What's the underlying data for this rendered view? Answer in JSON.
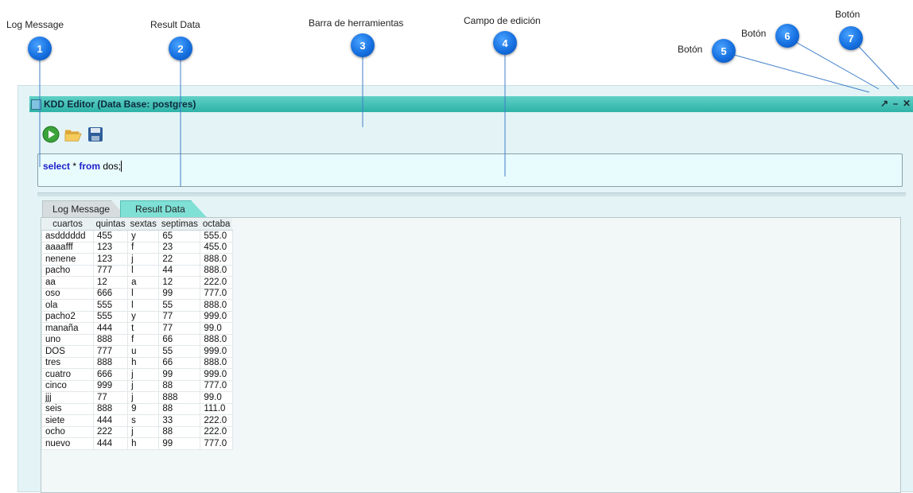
{
  "annotations": [
    {
      "number": "1",
      "label": "Log Message"
    },
    {
      "number": "2",
      "label": "Result Data"
    },
    {
      "number": "3",
      "label": "Barra de herramientas"
    },
    {
      "number": "4",
      "label": "Campo de edición"
    },
    {
      "number": "5",
      "label": "Botón"
    },
    {
      "number": "6",
      "label": "Botón"
    },
    {
      "number": "7",
      "label": "Botón"
    }
  ],
  "window": {
    "title": "KDD Editor (Data Base: postgres)",
    "controls": {
      "restore": "↗",
      "minimize": "–",
      "close": "✕"
    }
  },
  "toolbar": {
    "buttons": [
      {
        "icon": "run-icon",
        "color": "#3aa33a"
      },
      {
        "icon": "open-folder-icon",
        "color": "#f2c14e"
      },
      {
        "icon": "save-icon",
        "color": "#2f5f9a"
      }
    ]
  },
  "editor": {
    "keyword_select": "select",
    "operator": " * ",
    "keyword_from": "from",
    "rest": " dos;"
  },
  "tabs": [
    {
      "label": "Log Message",
      "active": false
    },
    {
      "label": "Result Data",
      "active": true
    }
  ],
  "table": {
    "columns": [
      "cuartos",
      "quintas",
      "sextas",
      "septimas",
      "octaba"
    ],
    "rows": [
      [
        "asdddddd",
        "455",
        "y",
        "65",
        "555.0"
      ],
      [
        "aaaafff",
        "123",
        "f",
        "23",
        "455.0"
      ],
      [
        "nenene",
        "123",
        "j",
        "22",
        "888.0"
      ],
      [
        "pacho",
        "777",
        "l",
        "44",
        "888.0"
      ],
      [
        "aa",
        "12",
        "a",
        "12",
        "222.0"
      ],
      [
        "oso",
        "666",
        "l",
        "99",
        "777.0"
      ],
      [
        "ola",
        "555",
        "l",
        "55",
        "888.0"
      ],
      [
        "pacho2",
        "555",
        "y",
        "77",
        "999.0"
      ],
      [
        "manaña",
        "444",
        "t",
        "77",
        "99.0"
      ],
      [
        "uno",
        "888",
        "f",
        "66",
        "888.0"
      ],
      [
        "DOS",
        "777",
        "u",
        "55",
        "999.0"
      ],
      [
        "tres",
        "888",
        "h",
        "66",
        "888.0"
      ],
      [
        "cuatro",
        "666",
        "j",
        "99",
        "999.0"
      ],
      [
        "cinco",
        "999",
        "j",
        "88",
        "777.0"
      ],
      [
        "jjj",
        "77",
        "j",
        "888",
        "99.0"
      ],
      [
        "seis",
        "888",
        "9",
        "88",
        "111.0"
      ],
      [
        "siete",
        "444",
        "s",
        "33",
        "222.0"
      ],
      [
        "ocho",
        "222",
        "j",
        "88",
        "222.0"
      ],
      [
        "nuevo",
        "444",
        "h",
        "99",
        "777.0"
      ]
    ]
  }
}
